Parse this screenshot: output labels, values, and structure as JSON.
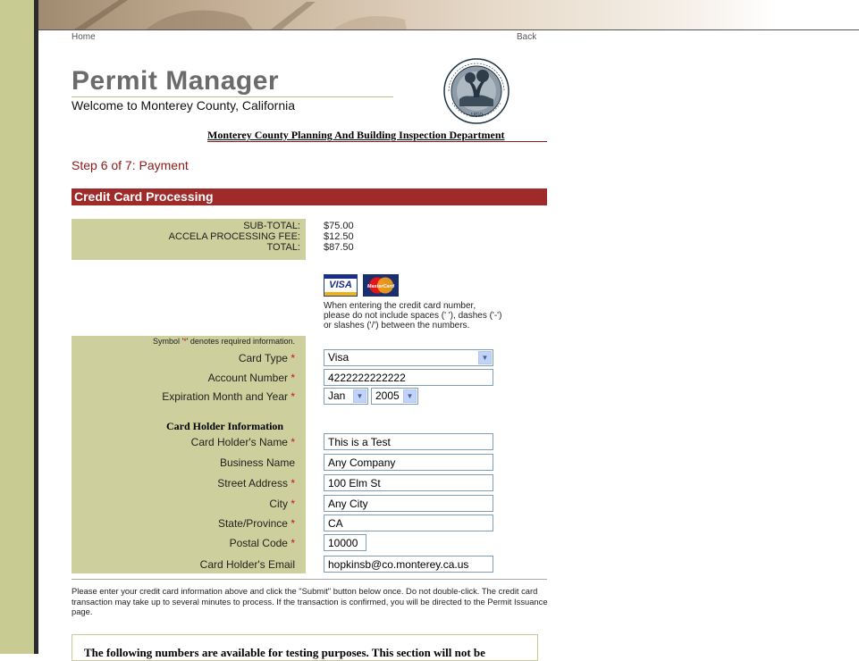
{
  "nav": {
    "home": "Home",
    "back": "Back"
  },
  "header": {
    "title": "Permit Manager",
    "welcome": "Welcome to Monterey County, California",
    "seal_top_text": "MONTEREY COUNTY CALIFORNIA",
    "seal_year": "1850",
    "department": "Monterey County Planning And Building Inspection Department"
  },
  "step": "Step 6 of 7: Payment",
  "section_title": "Credit Card Processing",
  "totals": [
    {
      "label": "SUB-TOTAL:",
      "value": "$75.00"
    },
    {
      "label": "ACCELA PROCESSING FEE:",
      "value": "$12.50"
    },
    {
      "label": "TOTAL:",
      "value": "$87.50"
    }
  ],
  "cards": {
    "visa": "VISA",
    "mastercard": "MasterCard"
  },
  "entry_note": [
    "When entering the credit card number,",
    "please do not include spaces (' '), dashes ('-')",
    "or slashes ('/') between the numbers."
  ],
  "required_note": {
    "prefix": "Symbol '",
    "star": "*",
    "suffix": "' denotes required information."
  },
  "form": {
    "card_type": {
      "label": "Card Type",
      "value": "Visa"
    },
    "account_number": {
      "label": "Account Number",
      "value": "4222222222222"
    },
    "expiration": {
      "label": "Expiration Month and Year",
      "month": "Jan",
      "year": "2005"
    },
    "holder_heading": "Card Holder Information",
    "holder_name": {
      "label": "Card Holder's Name",
      "value": "This is a Test"
    },
    "business_name": {
      "label": "Business Name",
      "value": "Any Company"
    },
    "street_address": {
      "label": "Street Address",
      "value": "100 Elm St"
    },
    "city": {
      "label": "City",
      "value": "Any City"
    },
    "state": {
      "label": "State/Province",
      "value": "CA"
    },
    "postal_code": {
      "label": "Postal Code",
      "value": "10000"
    },
    "email": {
      "label": "Card Holder's Email",
      "value": "hopkinsb@co.monterey.ca.us"
    }
  },
  "required_star": "*",
  "instructions": "Please enter your credit card information above and click the \"Submit\" button below once. Do not double-click. The credit card transaction may take up to several minutes to process. If the transaction is confirmed, you will be directed to the Permit Issuance page.",
  "testing_note": "The following numbers are available for testing purposes. This section will not be"
}
